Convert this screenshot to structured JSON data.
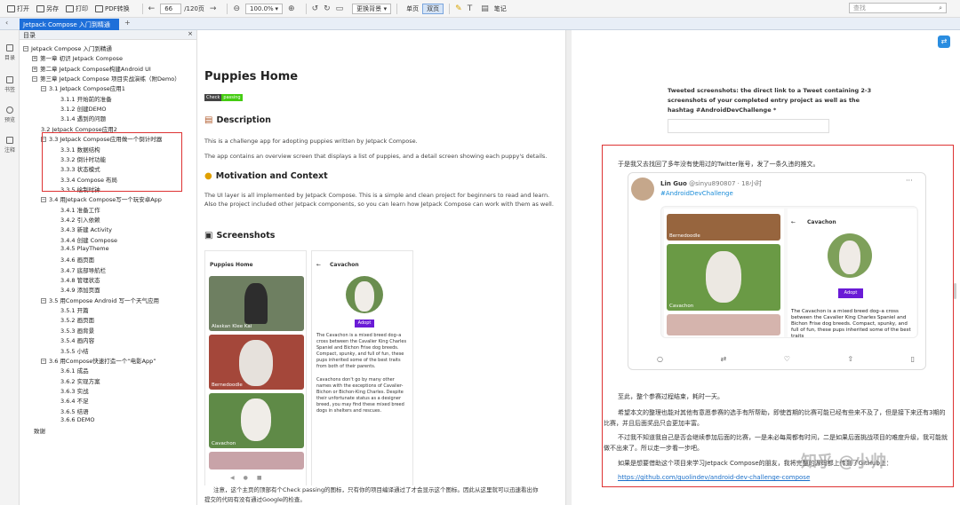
{
  "toolbar": {
    "open": "打开",
    "save": "另存",
    "print": "打印",
    "pdf_convert": "PDF转换",
    "page_current": "66",
    "page_total": "/120页",
    "zoom": "100.0%",
    "bg": "更换背景",
    "single": "单页",
    "double": "双页",
    "note": "笔记",
    "search_placeholder": "查找"
  },
  "tab": {
    "title": "Jetpack Compose 入门到精通"
  },
  "rail": {
    "toc": "目录",
    "bookmark": "书签",
    "preview": "预览",
    "note": "注释"
  },
  "toc": {
    "header": "目录",
    "items": [
      "Jetpack Compose 入门到精通",
      "第一章 初识 Jetpack Compose",
      "第二章 Jetpack Compose构建Android UI",
      "第三章 Jetpack Compose 项目实战演练（附Demo）",
      "3.1 Jetpack Compose应用1",
      "3.1.1 开始前的准备",
      "3.1.2 创建DEMO",
      "3.1.4 遇到的问题",
      "3.2 Jetpack Compose应用2",
      "3.3 Jetpack Compose应用做一个倒计时器",
      "3.3.1 数据结构",
      "3.3.2 倒计时功能",
      "3.3.3 状态模式",
      "3.3.4 Compose 布局",
      "3.3.5 绘制时钟",
      "3.4 用Jetpack Compose写一个玩安卓App",
      "3.4.1 准备工作",
      "3.4.2 引入依赖",
      "3.4.3 新建 Activity",
      "3.4.4 创建 Compose",
      "3.4.5 PlayTheme",
      "3.4.6  画页面",
      "3.4.7 底部导航栏",
      "3.4.8 管理状态",
      "3.4.9 添加页面",
      "3.5 用Compose Android 写一个天气应用",
      "3.5.1 开篇",
      "3.5.2 画页面",
      "3.5.3 画背景",
      "3.5.4 画内容",
      "3.5.5 小结",
      "3.6 用Compose快速打造一个“电影App”",
      "3.6.1 成品",
      "3.6.2 实现方案",
      "3.6.3 实战",
      "3.6.4 不足",
      "3.6.5 结语",
      "3.6.6 DEMO",
      "致谢"
    ]
  },
  "page1": {
    "title": "Puppies Home",
    "badge_left": "Check",
    "badge_right": "passing",
    "desc_h": "Description",
    "desc_p": "This is a challenge app for adopting puppies written by Jetpack Compose.",
    "desc_p2": "The app contains an overview screen that displays a list of puppies, and a detail screen showing each puppy's details.",
    "motiv_h": "Motivation and Context",
    "motiv_p": "The UI layer is all implemented by Jetpack Compose. This is a simple and clean project for beginners to read and learn. Also the project included other Jetpack components, so you can learn how Jetpack Compose can work with them as well.",
    "shots_h": "Screenshots",
    "phone_title": "Puppies Home",
    "dog1": "Alaskan Klee Kai",
    "dog2": "Bernedoodle",
    "dog3": "Cavachon",
    "detail_title": "Cavachon",
    "adopt": "Adopt",
    "detail_text": "The Cavachon is a mixed breed dog–a cross between the Cavalier King Charles Spaniel and Bichon Frise dog breeds. Compact, spunky, and full of fun, these pups inherited some of the best traits from both of their parents.",
    "detail_text2": "Cavachons don't go by many other names with the exceptions of Cavalier-Bichon or Bichon-King Charles. Despite their unfortunate status as a designer breed, you may find these mixed breed dogs in shelters and rescues.",
    "bottom_note": "注意，这个主页的顶部有个Check passing的图标，只有你的项目编译通过了才会显示这个图标。因此从这里就可以迅速看出你提交的代码有没有通过Google的检查。"
  },
  "page2": {
    "tweet_note": "Tweeted screenshots: the direct link to a Tweet containing 2-3 screenshots of your completed entry project as well as the hashtag #AndroidDevChallenge *",
    "intro": "于是我又去找回了多年没有使用过的Twitter账号，发了一条久违的推文。",
    "tweet_name": "Lin Guo",
    "tweet_handle": "@sinyu890807 · 18小时",
    "tweet_tag": "#AndroidDevChallenge",
    "t_dog1": "Bernedoodle",
    "t_dog2": "Cavachon",
    "t_detail": "Cavachon",
    "t_adopt": "Adopt",
    "t_text": "The Cavachon is a mixed breed dog–a cross between the Cavalier King Charles Spaniel and Bichon Frise dog breeds. Compact, spunky, and full of fun, these pups inherited some of the best traits",
    "p1": "至此，整个参赛过程结束，耗时一天。",
    "p2": "希望本文的整理也能对其他有意愿参赛的选手有所帮助，即使首期的比赛可能已经有些来不及了，但是接下来还有3期的比赛，并且后面奖品只会更加丰富。",
    "p3": "不过我不知道我自己是否会继续参加后面的比赛，一是未必每周都有时间，二是如果后面挑战项目的难度升级，我可能就做不出来了。所以走一步看一步吧。",
    "p4": "如果是想要借助这个项目来学习Jetpack Compose的朋友，我将完整的源码都上传到了GitHub上：",
    "url": "https://github.com/guolindev/android-dev-challenge-compose",
    "watermark": "知乎 @小帅"
  }
}
